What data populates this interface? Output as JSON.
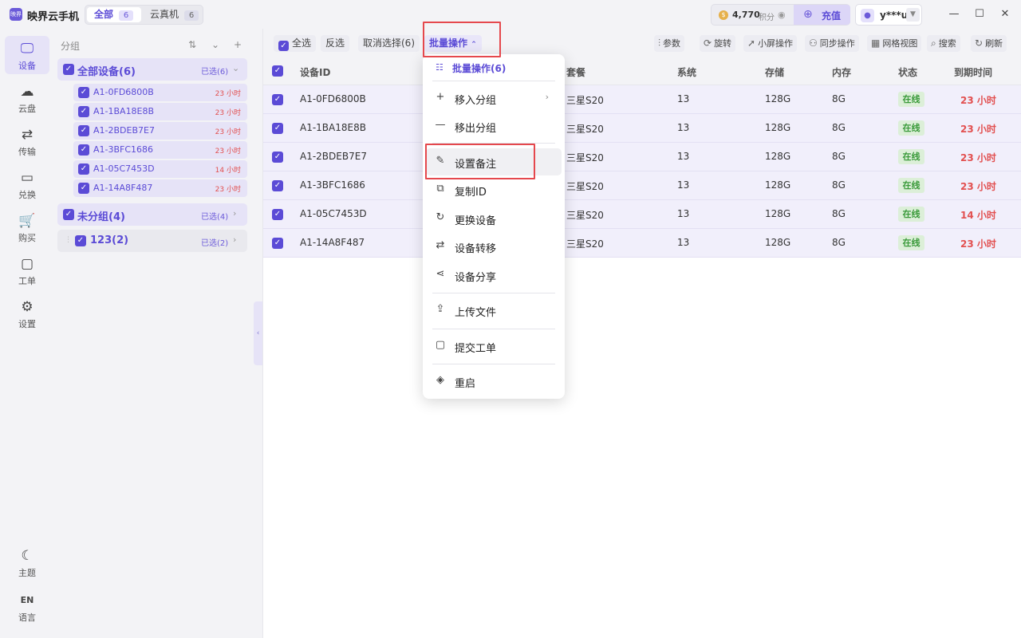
{
  "app": {
    "logo_text": "映界",
    "title": "映界云手机"
  },
  "top_tabs": [
    {
      "label": "全部",
      "count": "6"
    },
    {
      "label": "云真机",
      "count": "6"
    }
  ],
  "points": {
    "value": "4,770",
    "unit": "积分",
    "recharge": "充值"
  },
  "user": {
    "name": "y***u"
  },
  "rail": [
    {
      "label": "设备",
      "icon": "monitor-icon"
    },
    {
      "label": "云盘",
      "icon": "cloud-icon"
    },
    {
      "label": "传输",
      "icon": "transfer-icon"
    },
    {
      "label": "兑换",
      "icon": "ticket-icon"
    },
    {
      "label": "购买",
      "icon": "cart-icon"
    },
    {
      "label": "工单",
      "icon": "message-icon"
    },
    {
      "label": "设置",
      "icon": "gear-icon"
    },
    {
      "label": "主题",
      "icon": "moon-icon"
    },
    {
      "label": "语言",
      "icon_text": "EN"
    }
  ],
  "groups": {
    "title": "分组",
    "all": {
      "name": "全部设备(6)",
      "selected": "已选(6)"
    },
    "devices": [
      {
        "id": "A1-0FD6800B",
        "time": "23 小时"
      },
      {
        "id": "A1-1BA18E8B",
        "time": "23 小时"
      },
      {
        "id": "A1-2BDEB7E7",
        "time": "23 小时"
      },
      {
        "id": "A1-3BFC1686",
        "time": "23 小时"
      },
      {
        "id": "A1-05C7453D",
        "time": "14 小时"
      },
      {
        "id": "A1-14A8F487",
        "time": "23 小时"
      }
    ],
    "ungrouped": {
      "name": "未分组(4)",
      "selected": "已选(4)"
    },
    "custom": {
      "name": "123(2)",
      "selected": "已选(2)"
    }
  },
  "toolbar": {
    "select_all": "全选",
    "invert": "反选",
    "cancel": "取消选择(6)",
    "batch": "批量操作",
    "right": [
      "参数",
      "旋转",
      "小屏操作",
      "同步操作",
      "网格视图",
      "搜索",
      "刷新"
    ]
  },
  "table": {
    "headers": [
      "设备ID",
      "套餐",
      "系统",
      "存储",
      "内存",
      "状态",
      "到期时间"
    ],
    "rows": [
      {
        "id": "A1-0FD6800B",
        "plan": "三星S20",
        "system": "13",
        "storage": "128G",
        "memory": "8G",
        "status": "在线",
        "expire": "23 小时"
      },
      {
        "id": "A1-1BA18E8B",
        "plan": "三星S20",
        "system": "13",
        "storage": "128G",
        "memory": "8G",
        "status": "在线",
        "expire": "23 小时"
      },
      {
        "id": "A1-2BDEB7E7",
        "plan": "三星S20",
        "system": "13",
        "storage": "128G",
        "memory": "8G",
        "status": "在线",
        "expire": "23 小时"
      },
      {
        "id": "A1-3BFC1686",
        "plan": "三星S20",
        "system": "13",
        "storage": "128G",
        "memory": "8G",
        "status": "在线",
        "expire": "23 小时"
      },
      {
        "id": "A1-05C7453D",
        "plan": "三星S20",
        "system": "13",
        "storage": "128G",
        "memory": "8G",
        "status": "在线",
        "expire": "14 小时"
      },
      {
        "id": "A1-14A8F487",
        "plan": "三星S20",
        "system": "13",
        "storage": "128G",
        "memory": "8G",
        "status": "在线",
        "expire": "23 小时"
      }
    ]
  },
  "menu": {
    "header": "批量操作(6)",
    "items": [
      {
        "label": "移入分组",
        "icon": "plus-icon"
      },
      {
        "label": "移出分组",
        "icon": "minus-icon"
      },
      {
        "label": "设置备注",
        "icon": "edit-icon"
      },
      {
        "label": "复制ID",
        "icon": "copy-icon"
      },
      {
        "label": "更换设备",
        "icon": "refresh-icon"
      },
      {
        "label": "设备转移",
        "icon": "swap-icon"
      },
      {
        "label": "设备分享",
        "icon": "share-icon"
      },
      {
        "label": "上传文件",
        "icon": "upload-icon"
      },
      {
        "label": "提交工单",
        "icon": "message-icon"
      },
      {
        "label": "重启",
        "icon": "layers-icon"
      }
    ]
  },
  "colors": {
    "accent": "#5b4bd6",
    "danger": "#e25050",
    "online": "#3a9a3a",
    "highlight": "#e5484d"
  }
}
